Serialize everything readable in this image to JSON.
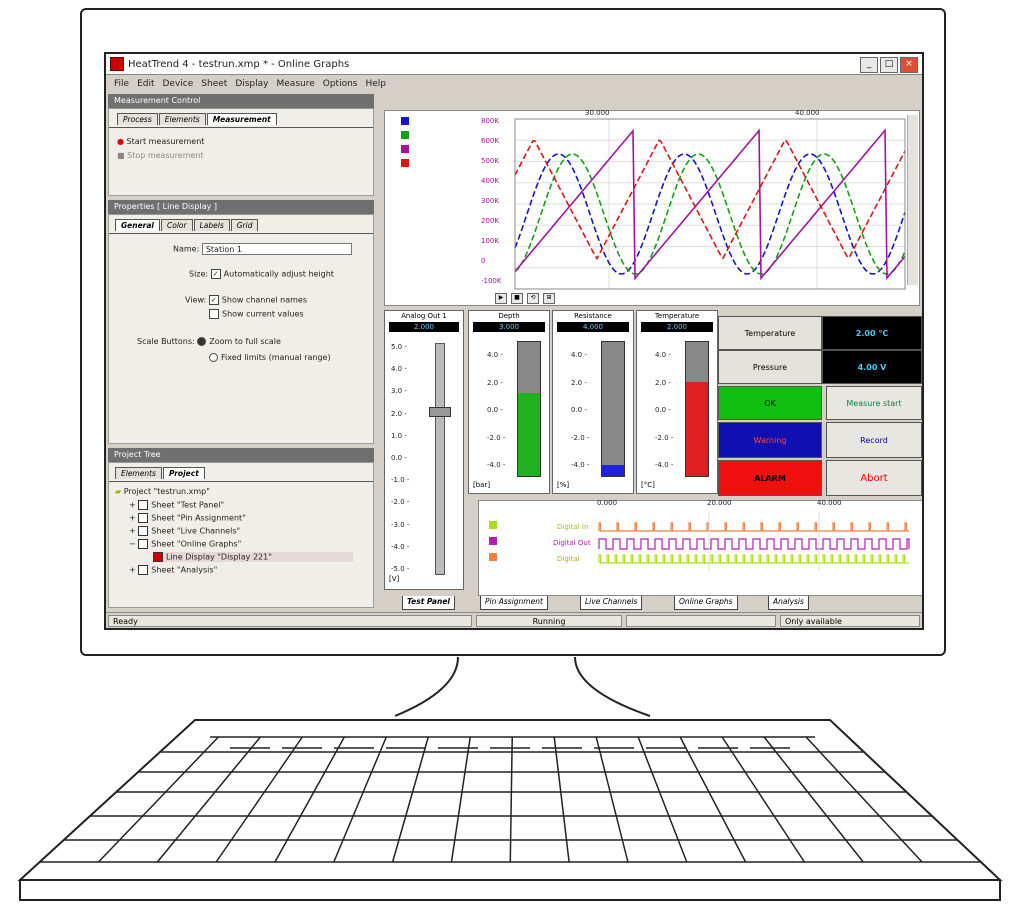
{
  "window": {
    "title": "HeatTrend 4 - testrun.xmp * - Online Graphs",
    "buttons": [
      "_",
      "□",
      "×"
    ]
  },
  "menu": [
    "File",
    "Edit",
    "Device",
    "Sheet",
    "Display",
    "Measure",
    "Options",
    "Help"
  ],
  "measurement_panel": {
    "header": "Measurement Control",
    "tabs": [
      "Process",
      "Elements",
      "Measurement"
    ],
    "items": [
      "Start measurement",
      "Stop measurement"
    ]
  },
  "properties_panel": {
    "header": "Properties [ Line Display ]",
    "tabs": [
      "General",
      "Color",
      "Labels",
      "Grid"
    ],
    "name_label": "Name:",
    "name_value": "Station 1",
    "size_label": "Size:",
    "size_option": "Automatically adjust height",
    "view_label": "View:",
    "view_options": [
      "Show channel names",
      "Show current values"
    ],
    "scale_label": "Scale Buttons:",
    "scale_options": [
      "Zoom to full scale",
      "Fixed limits (manual range)"
    ]
  },
  "project_panel": {
    "header": "Project Tree",
    "tabs": [
      "Elements",
      "Project"
    ],
    "tree": [
      "Project \"testrun.xmp\"",
      "Sheet \"Test Panel\"",
      "Sheet \"Pin Assignment\"",
      "Sheet \"Live Channels\"",
      "Sheet \"Online Graphs\"",
      "Line Display \"Display 221\"",
      "Sheet \"Analysis\""
    ]
  },
  "graph": {
    "x_ticks": [
      "30.000",
      "40.000"
    ],
    "y_ticks": [
      "800K",
      "600K",
      "500K",
      "400K",
      "300K",
      "200K",
      "100K",
      "0",
      "-100K"
    ],
    "legend_colors": [
      "#1414c8",
      "#14a014",
      "#a014a0",
      "#e01414"
    ],
    "toolbar": [
      "▶",
      "■",
      "⟲",
      "⊞"
    ]
  },
  "gauges": [
    {
      "title": "Analog Out 1",
      "value": "2.000",
      "ticks": [
        "5.0",
        "4.0",
        "3.0",
        "2.0",
        "1.0",
        "0.0",
        "-1.0",
        "-2.0",
        "-3.0",
        "-4.0",
        "-5.0"
      ],
      "unit": "[V]"
    },
    {
      "title": "Depth",
      "value": "3.000",
      "ticks": [
        "4.0",
        "2.0",
        "0.0",
        "-2.0",
        "-4.0"
      ],
      "unit": "[bar]",
      "fill": 0.62,
      "color": "#20b020"
    },
    {
      "title": "Resistance",
      "value": "4.000",
      "ticks": [
        "4.0",
        "2.0",
        "0.0",
        "-2.0",
        "-4.0"
      ],
      "unit": "[%]",
      "fill": 0.08,
      "color": "#2020e0"
    },
    {
      "title": "Temperature",
      "value": "2.000",
      "ticks": [
        "4.0",
        "2.0",
        "0.0",
        "-2.0",
        "-4.0"
      ],
      "unit": "[°C]",
      "fill": 0.7,
      "color": "#e02020"
    }
  ],
  "buttons_grid": {
    "temp_label": "Temperature",
    "temp_value": "2.00 °C",
    "pressure_label": "Pressure",
    "pressure_value": "4.00 V",
    "ok": "OK",
    "warn": "Warning",
    "alarm": "ALARM",
    "measure_start": "Measure start",
    "record": "Record",
    "abort": "Abort"
  },
  "digital": {
    "x_ticks": [
      "0.000",
      "20.000",
      "40.000"
    ],
    "channels": [
      "Digital In",
      "Digital Out",
      "Digital"
    ],
    "legend_colors": [
      "#a8e020",
      "#b020b0",
      "#f08040"
    ]
  },
  "bottom_tabs": [
    "Test Panel",
    "Pin Assignment",
    "Live Channels",
    "Online Graphs",
    "Analysis"
  ],
  "status": {
    "left": "Ready",
    "center": "Running",
    "right": "Only available"
  }
}
